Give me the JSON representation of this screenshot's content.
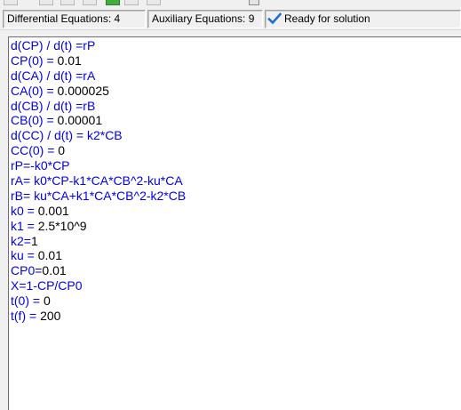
{
  "colors": {
    "code_blue": "#0000ee",
    "number_black": "#000000",
    "check_blue": "#1f6fd1"
  },
  "status_bar": {
    "differential_equations": "Differential Equations: 4",
    "auxiliary_equations": "Auxiliary Equations: 9",
    "status_icon": "checkmark-icon",
    "status_text": "Ready for solution"
  },
  "editor": {
    "lines": [
      [
        {
          "t": "d(CP) / d(t) =rP",
          "k": "code"
        }
      ],
      [
        {
          "t": "CP(0) = ",
          "k": "code"
        },
        {
          "t": "0.01",
          "k": "num"
        }
      ],
      [
        {
          "t": "d(CA) / d(t) =rA",
          "k": "code"
        }
      ],
      [
        {
          "t": "CA(0) = ",
          "k": "code"
        },
        {
          "t": "0.000025",
          "k": "num"
        }
      ],
      [
        {
          "t": "d(CB) / d(t) =rB",
          "k": "code"
        }
      ],
      [
        {
          "t": "CB(0) = ",
          "k": "code"
        },
        {
          "t": "0.00001",
          "k": "num"
        }
      ],
      [
        {
          "t": "d(CC) / d(t) = k2*CB",
          "k": "code"
        }
      ],
      [
        {
          "t": "CC(0) = ",
          "k": "code"
        },
        {
          "t": "0",
          "k": "num"
        }
      ],
      [
        {
          "t": "rP=-k0*CP",
          "k": "code"
        }
      ],
      [
        {
          "t": "rA= k0*CP-k1*CA*CB^2-ku*CA",
          "k": "code"
        }
      ],
      [
        {
          "t": "rB= ku*CA+k1*CA*CB^2-k2*CB",
          "k": "code"
        }
      ],
      [
        {
          "t": "k0 = ",
          "k": "code"
        },
        {
          "t": "0.001",
          "k": "num"
        }
      ],
      [
        {
          "t": "k1 = ",
          "k": "code"
        },
        {
          "t": "2.5*10^9",
          "k": "num"
        }
      ],
      [
        {
          "t": "k2=",
          "k": "code"
        },
        {
          "t": "1",
          "k": "num"
        }
      ],
      [
        {
          "t": "ku = ",
          "k": "code"
        },
        {
          "t": "0.01",
          "k": "num"
        }
      ],
      [
        {
          "t": "CP0=",
          "k": "code"
        },
        {
          "t": "0.01",
          "k": "num"
        }
      ],
      [
        {
          "t": "X=1-CP/CP0",
          "k": "code"
        }
      ],
      [
        {
          "t": "t(0) = ",
          "k": "code"
        },
        {
          "t": "0",
          "k": "num"
        }
      ],
      [
        {
          "t": "t(f) = ",
          "k": "code"
        },
        {
          "t": "200",
          "k": "num"
        }
      ]
    ]
  }
}
